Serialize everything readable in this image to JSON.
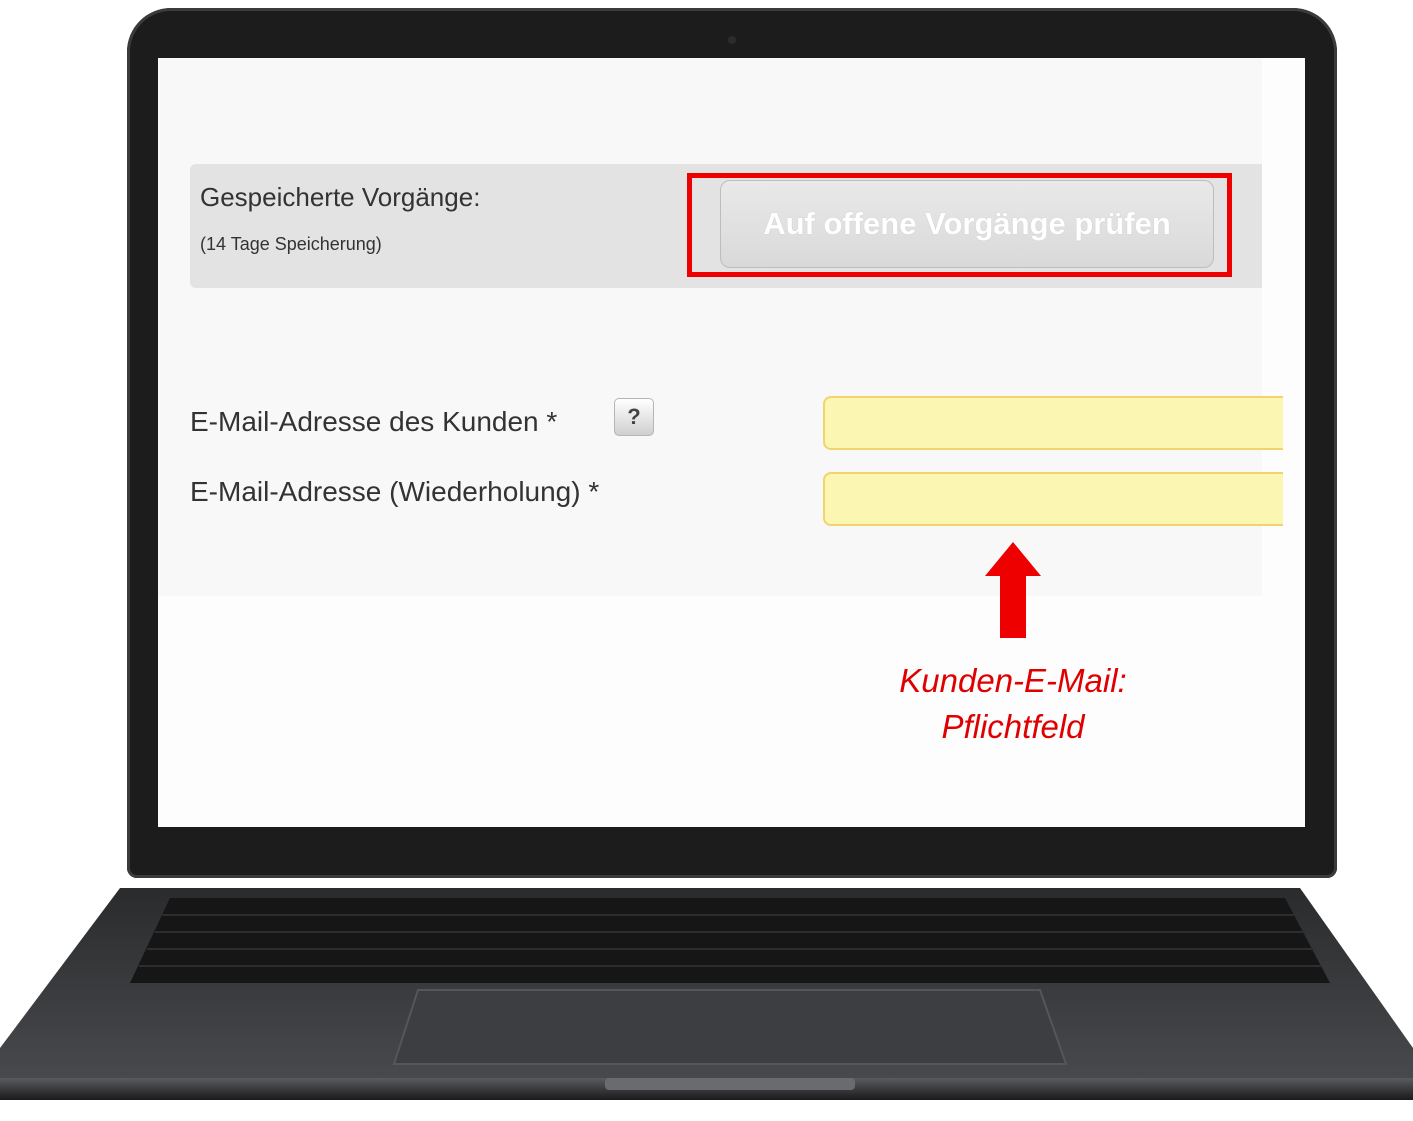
{
  "saved_processes": {
    "title": "Gespeicherte Vorgänge:",
    "subtitle": "(14 Tage Speicherung)",
    "check_button_label": "Auf offene Vorgänge prüfen"
  },
  "form": {
    "customer_email_label": "E-Mail-Adresse des Kunden *",
    "help_icon_glyph": "?",
    "customer_email_value": "",
    "repeat_email_label": "E-Mail-Adresse (Wiederholung) *",
    "repeat_email_value": ""
  },
  "annotation": {
    "line1": "Kunden-E-Mail:",
    "line2": "Pflichtfeld",
    "color": "#e00000"
  },
  "colors": {
    "input_background": "#fbf6b2",
    "highlight_border": "#ee0000",
    "laptop_body": "#1c1c1d"
  }
}
